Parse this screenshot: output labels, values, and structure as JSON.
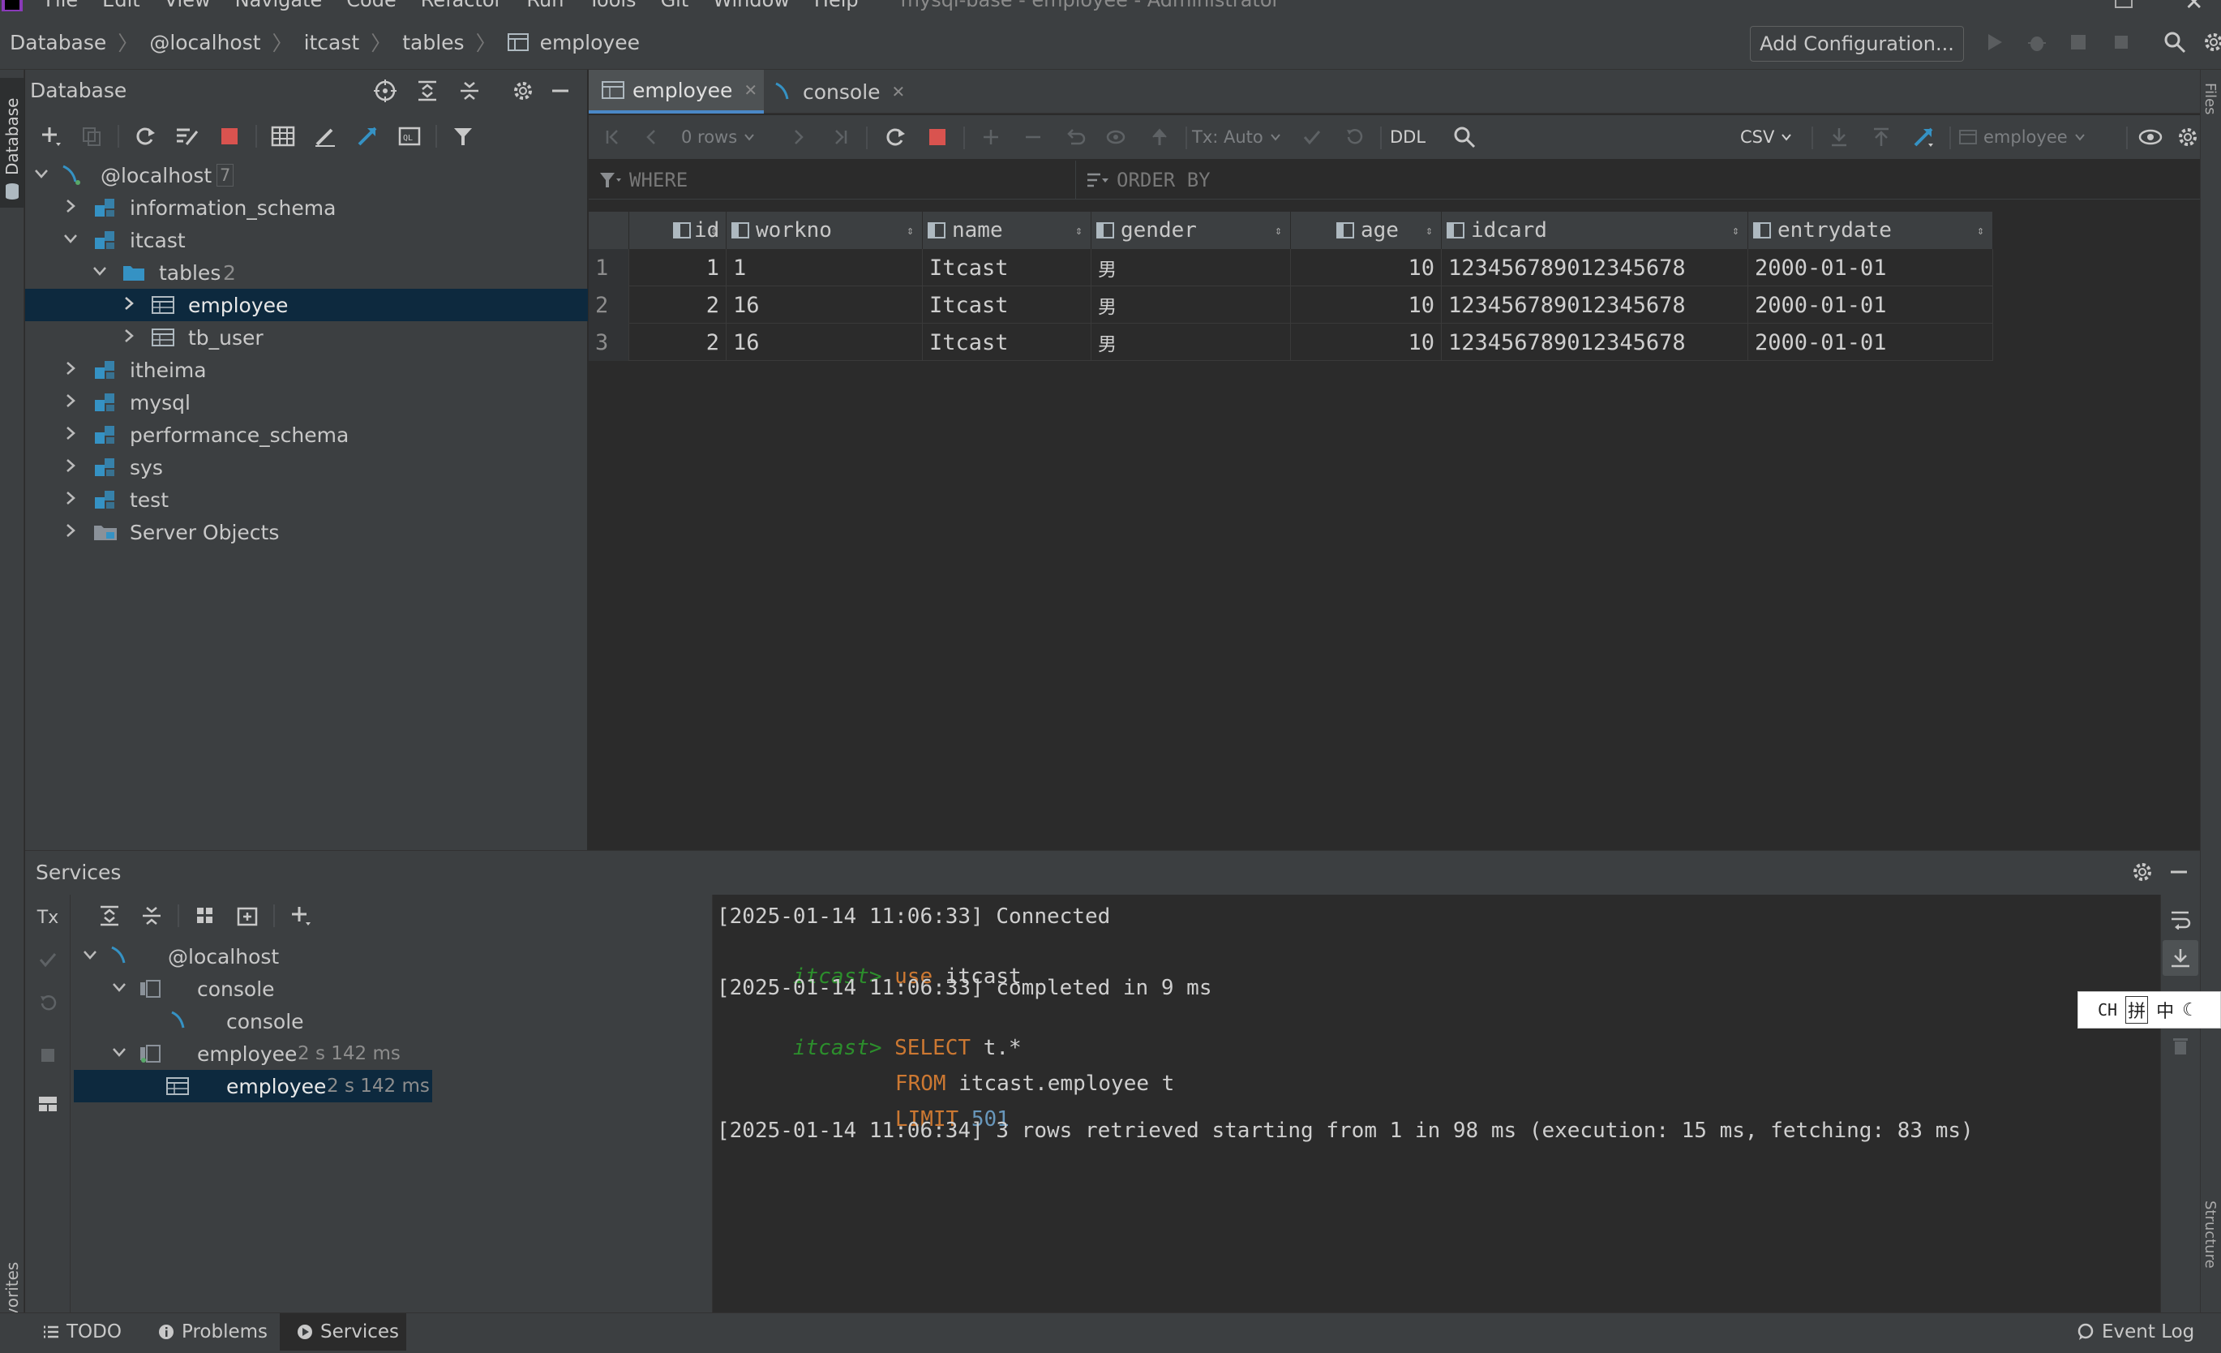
{
  "menu": {
    "items": [
      "File",
      "Edit",
      "View",
      "Navigate",
      "Code",
      "Refactor",
      "Run",
      "Tools",
      "Git",
      "Window",
      "Help"
    ],
    "title": "mysql-base - employee - Administrator"
  },
  "breadcrumb": {
    "items": [
      "Database",
      "@localhost",
      "itcast",
      "tables",
      "employee"
    ],
    "add_config": "Add Configuration..."
  },
  "side_tabs": {
    "database": "Database",
    "favorites": "Favorites",
    "files": "Files",
    "structure": "Structure"
  },
  "db_panel": {
    "title": "Database",
    "tree": {
      "host": "@localhost",
      "host_count": "7",
      "schemas": [
        "information_schema",
        "itcast",
        "itheima",
        "mysql",
        "performance_schema",
        "sys",
        "test",
        "Server Objects"
      ],
      "tables_label": "tables",
      "tables_count": "2",
      "tables": [
        "employee",
        "tb_user"
      ]
    }
  },
  "editor_tabs": [
    {
      "label": "employee",
      "active": true
    },
    {
      "label": "console",
      "active": false
    }
  ],
  "grid_toolbar": {
    "rows": "0 rows",
    "tx": "Tx: Auto",
    "ddl": "DDL",
    "csv": "CSV",
    "target": "employee"
  },
  "filter": {
    "where": "WHERE",
    "order_by": "ORDER BY"
  },
  "table": {
    "columns": [
      "id",
      "workno",
      "name",
      "gender",
      "age",
      "idcard",
      "entrydate"
    ],
    "rows": [
      {
        "n": "1",
        "cells": [
          "1",
          "1",
          "Itcast",
          "男",
          "10",
          "123456789012345678",
          "2000-01-01"
        ]
      },
      {
        "n": "2",
        "cells": [
          "2",
          "16",
          "Itcast",
          "男",
          "10",
          "123456789012345678",
          "2000-01-01"
        ]
      },
      {
        "n": "3",
        "cells": [
          "2",
          "16",
          "Itcast",
          "男",
          "10",
          "123456789012345678",
          "2000-01-01"
        ]
      }
    ]
  },
  "services": {
    "title": "Services",
    "tx_label": "Tx",
    "tree": {
      "host": "@localhost",
      "console_group": "console",
      "console_item": "console",
      "employee_group": "employee",
      "employee_group_time": "2 s 142 ms",
      "employee_item": "employee",
      "employee_item_time": "2 s 142 ms"
    },
    "log": {
      "l1": "[2025-01-14 11:06:33] Connected",
      "p2": "itcast>",
      "k2": "use",
      "t2": "itcast",
      "l3": "[2025-01-14 11:06:33] completed in 9 ms",
      "p4": "itcast>",
      "k4": "SELECT",
      "t4": "t.*",
      "k5": "FROM",
      "t5": "itcast.employee t",
      "k6": "LIMIT",
      "n6": "501",
      "l7": "[2025-01-14 11:06:34] 3 rows retrieved starting from 1 in 98 ms (execution: 15 ms, fetching: 83 ms)"
    }
  },
  "ime": {
    "a": "CH",
    "b": "拼",
    "c": "中",
    "d": "☾"
  },
  "statusbar": {
    "todo": "TODO",
    "problems": "Problems",
    "services": "Services",
    "event_log": "Event Log"
  },
  "colors": {
    "selection": "#0d293e",
    "accent": "#3592c4",
    "keyword": "#cc7832",
    "prompt": "#2c8f2c",
    "number": "#6897bb"
  }
}
